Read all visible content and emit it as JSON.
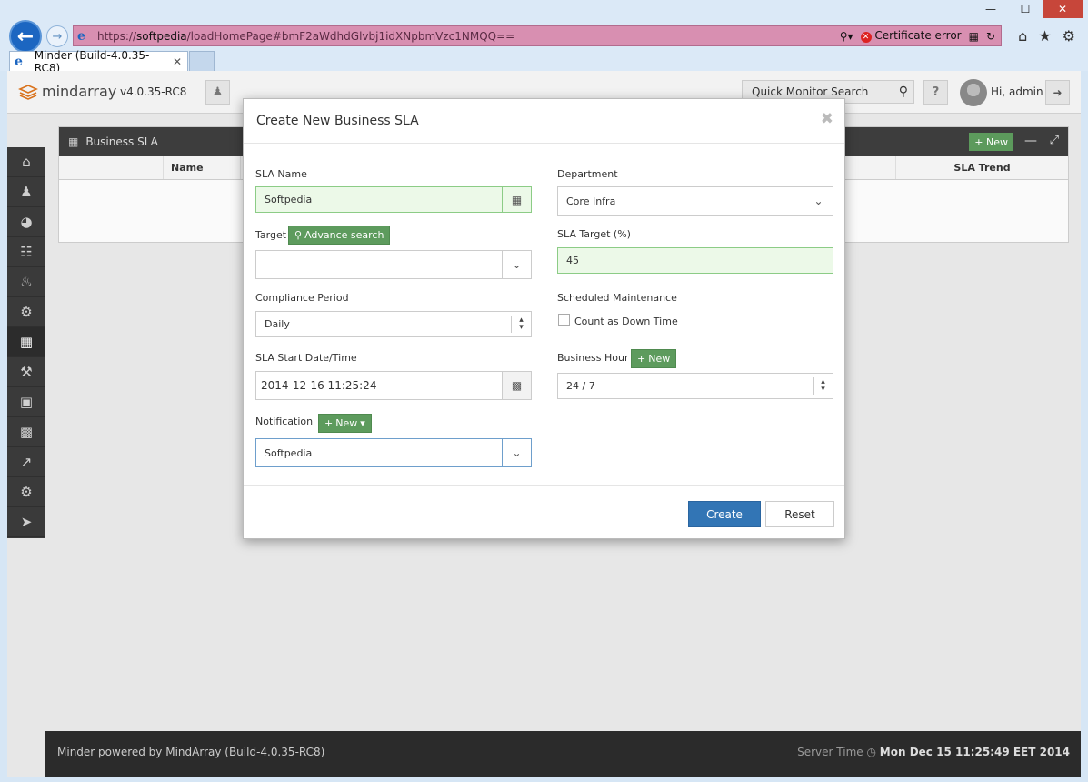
{
  "browser": {
    "url_scheme": "https://",
    "url_host": "softpedia",
    "url_path": "/loadHomePage#bmF2aWdhdGlvbj1idXNpbmVzc1NMQQ==",
    "cert_error": "Certificate error",
    "tab_title": "Minder (Build-4.0.35-RC8)"
  },
  "header": {
    "logo_text": "mindarray",
    "version": "v4.0.35-RC8",
    "search_placeholder": "Quick Monitor Search",
    "greeting": "Hi, admin"
  },
  "panel": {
    "title": "Business SLA",
    "new_label": "New",
    "col_name": "Name",
    "col_trend": "SLA Trend"
  },
  "modal": {
    "title": "Create New Business SLA",
    "sla_name_label": "SLA Name",
    "sla_name_value": "Softpedia",
    "department_label": "Department",
    "department_value": "Core Infra",
    "target_label": "Target",
    "advance_search_label": "Advance search",
    "target_value": "",
    "sla_target_label": "SLA Target (%)",
    "sla_target_value": "45",
    "compliance_label": "Compliance Period",
    "compliance_value": "Daily",
    "maintenance_label": "Scheduled Maintenance",
    "count_down_label": "Count as Down Time",
    "start_label": "SLA Start Date/Time",
    "start_value": "2014-12-16 11:25:24",
    "business_hour_label": "Business Hour",
    "business_hour_new": "New",
    "business_hour_value": "24 / 7",
    "notification_label": "Notification",
    "notification_new": "New",
    "notification_value": "Softpedia",
    "create_label": "Create",
    "reset_label": "Reset"
  },
  "footer": {
    "powered": "Minder powered by MindArray (Build-4.0.35-RC8)",
    "server_time_label": "Server Time",
    "server_time_value": "Mon Dec 15 11:25:49 EET 2014"
  }
}
